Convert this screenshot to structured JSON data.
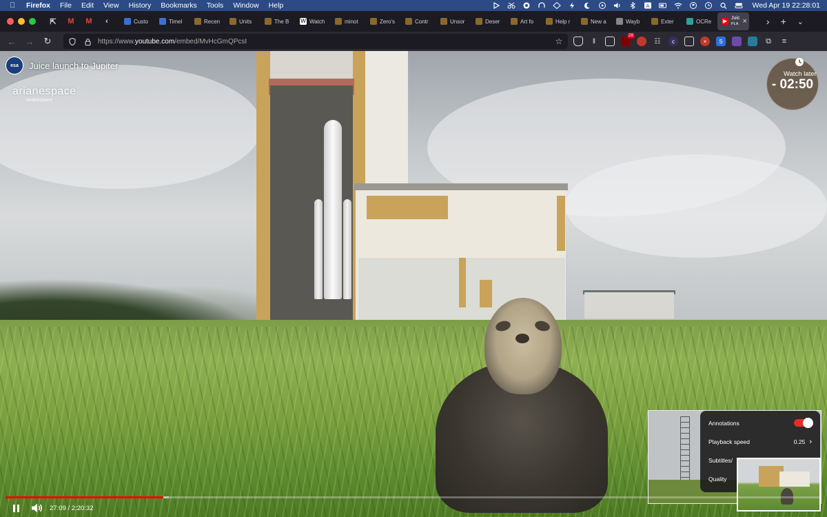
{
  "menubar": {
    "app_name": "Firefox",
    "items": [
      "File",
      "Edit",
      "View",
      "History",
      "Bookmarks",
      "Tools",
      "Window",
      "Help"
    ],
    "clock": "Wed Apr 19  22:28:01"
  },
  "tabs": {
    "pinned_icons": [
      "pinned-page-icon",
      "gmail-icon",
      "gmail-icon"
    ],
    "items": [
      {
        "label": "Custo",
        "favicon": "hb-icon",
        "color": "#3b6fd8"
      },
      {
        "label": "Timel",
        "favicon": "hb-icon",
        "color": "#3b6fd8"
      },
      {
        "label": "Recen",
        "favicon": "star-icon",
        "color": "#8a6a2a"
      },
      {
        "label": "Units",
        "favicon": "star-icon",
        "color": "#8a6a2a"
      },
      {
        "label": "The B",
        "favicon": "star-icon",
        "color": "#8a6a2a"
      },
      {
        "label": "Watch",
        "favicon": "w-icon",
        "color": "#ffffff"
      },
      {
        "label": "minot",
        "favicon": "star-icon",
        "color": "#8a6a2a"
      },
      {
        "label": "Zero's",
        "favicon": "star-icon",
        "color": "#8a6a2a"
      },
      {
        "label": "Contr",
        "favicon": "star-icon",
        "color": "#8a6a2a"
      },
      {
        "label": "Unsor",
        "favicon": "star-icon",
        "color": "#8a6a2a"
      },
      {
        "label": "Deser",
        "favicon": "star-icon",
        "color": "#8a6a2a"
      },
      {
        "label": "Art fo",
        "favicon": "star-icon",
        "color": "#8a6a2a"
      },
      {
        "label": "Help r",
        "favicon": "star-icon",
        "color": "#8a6a2a"
      },
      {
        "label": "New a",
        "favicon": "star-icon",
        "color": "#8a6a2a"
      },
      {
        "label": "Wayb",
        "favicon": "archive-icon",
        "color": "#888888"
      },
      {
        "label": "Exter",
        "favicon": "star-icon",
        "color": "#8a6a2a"
      },
      {
        "label": "OCRe",
        "favicon": "ocr-icon",
        "color": "#2aa198"
      }
    ],
    "active": {
      "label": "Juic",
      "sublabel": "PLA",
      "favicon": "youtube-icon",
      "color": "#ff0000"
    }
  },
  "navbar": {
    "url_prefix": "https://www.",
    "url_host": "youtube.com",
    "url_path": "/embed/MvHcGmQPcsI",
    "extension_badge": "28"
  },
  "video": {
    "title": "Juice launch to Jupiter",
    "channel_avatar_text": "esa",
    "brand": "arianespace",
    "brand_sub": "arianespace",
    "watch_later_label": "Watch later",
    "countdown": "- 02:50",
    "current_time": "27:09",
    "duration": "2:20:32",
    "time_display": "27:09 / 2:20:32",
    "progress_fraction": 0.193,
    "buffered_fraction": 0.2
  },
  "settings_menu": {
    "annotations_label": "Annotations",
    "annotations_on": true,
    "playback_speed_label": "Playback speed",
    "playback_speed_value": "0.25",
    "subtitles_label": "Subtitles/",
    "quality_label": "Quality"
  }
}
